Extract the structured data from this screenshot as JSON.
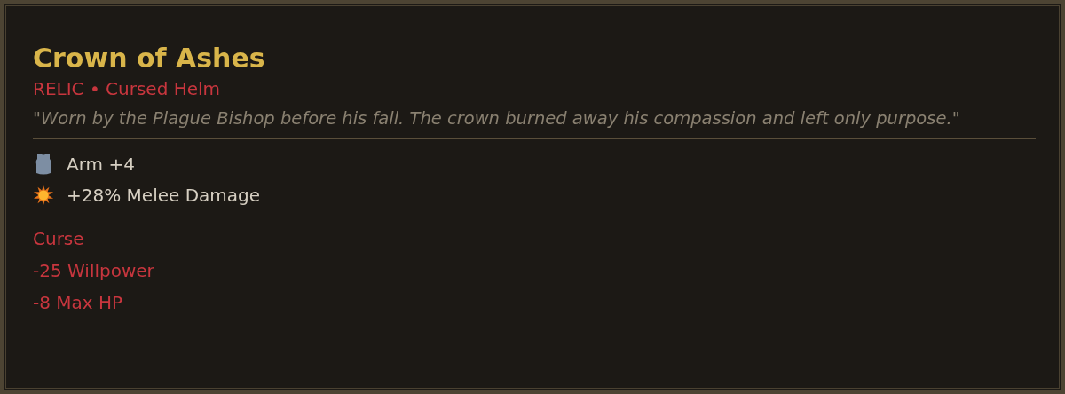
{
  "item": {
    "name": "Crown of Ashes",
    "type_line": "RELIC • Cursed Helm",
    "lore": "\"Worn by the Plague Bishop before his fall. The crown burned away his compassion and left only purpose.\""
  },
  "stats": [
    {
      "kind": "armor",
      "text": "Arm +4"
    },
    {
      "kind": "burst",
      "text": "+28% Melee Damage"
    }
  ],
  "curse": {
    "title": "Curse",
    "effects": [
      "-25 Willpower",
      "-8 Max HP"
    ]
  }
}
